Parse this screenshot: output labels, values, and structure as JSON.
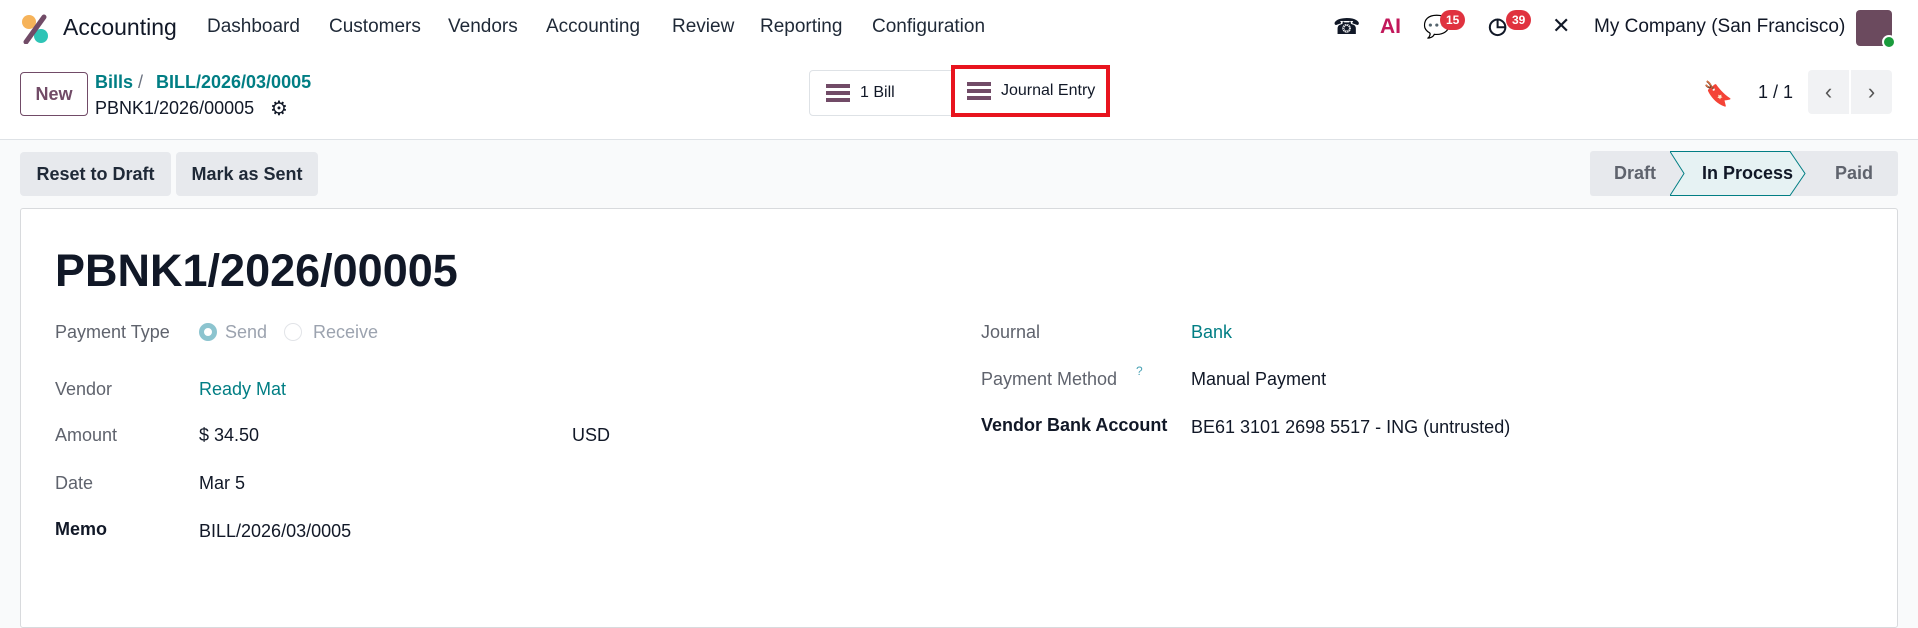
{
  "navbar": {
    "app_name": "Accounting",
    "menu": [
      "Dashboard",
      "Customers",
      "Vendors",
      "Accounting",
      "Review",
      "Reporting",
      "Configuration"
    ],
    "messages_count": "15",
    "activities_count": "39",
    "ai_label": "AI",
    "company": "My Company (San Francisco)"
  },
  "control_panel": {
    "new_label": "New",
    "breadcrumb": [
      "Bills",
      "BILL/2026/03/0005"
    ],
    "record_name": "PBNK1/2026/00005",
    "smart_buttons": [
      "1 Bill",
      "Journal Entry"
    ],
    "pager": "1 / 1"
  },
  "actions": {
    "reset": "Reset to Draft",
    "mark_sent": "Mark as Sent"
  },
  "statusbar": {
    "stages": [
      "Draft",
      "In Process",
      "Paid"
    ],
    "active": "In Process"
  },
  "form": {
    "title": "PBNK1/2026/00005",
    "payment_type": {
      "label": "Payment Type",
      "options": [
        "Send",
        "Receive"
      ],
      "selected": "Send"
    },
    "vendor": {
      "label": "Vendor",
      "value": "Ready Mat"
    },
    "amount": {
      "label": "Amount",
      "value": "$ 34.50",
      "currency": "USD"
    },
    "date": {
      "label": "Date",
      "value": "Mar 5"
    },
    "memo": {
      "label": "Memo",
      "value": "BILL/2026/03/0005"
    },
    "journal": {
      "label": "Journal",
      "value": "Bank"
    },
    "payment_method": {
      "label": "Payment Method",
      "help": "?",
      "value": "Manual Payment"
    },
    "bank_account": {
      "label": "Vendor Bank Account",
      "value": "BE61 3101 2698 5517 - ING (untrusted)"
    }
  },
  "colors": {
    "brand": "#714b67",
    "link": "#017e84",
    "highlight": "#e8141e",
    "badge": "#e0323f"
  }
}
